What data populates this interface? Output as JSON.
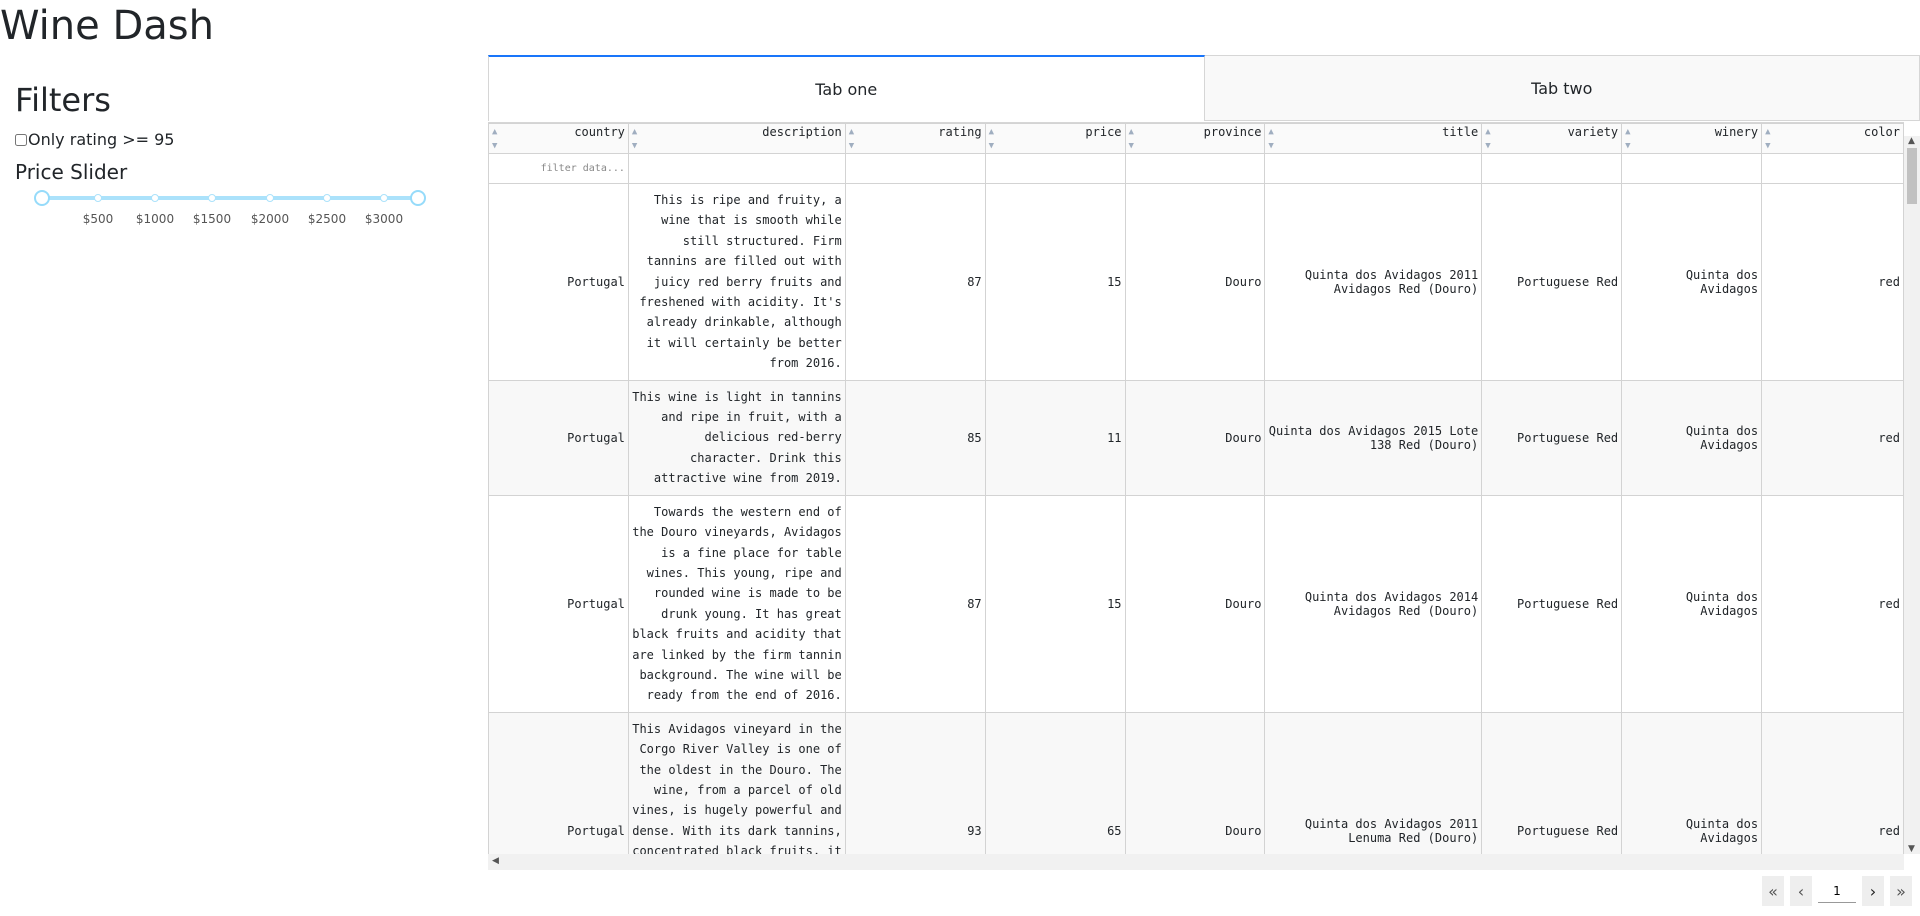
{
  "app": {
    "title": "Wine Dash"
  },
  "sidebar": {
    "filters_title": "Filters",
    "rating_checkbox_label": "Only rating >= 95",
    "rating_checked": false,
    "price_slider": {
      "title": "Price Slider",
      "marks": [
        "$500",
        "$1000",
        "$1500",
        "$2000",
        "$2500",
        "$3000"
      ],
      "range": [
        0,
        3300
      ],
      "selected": [
        0,
        3300
      ],
      "accent": "#96dbfa"
    }
  },
  "tabs": [
    {
      "label": "Tab one",
      "active": true
    },
    {
      "label": "Tab two",
      "active": false
    }
  ],
  "table": {
    "columns": [
      "country",
      "description",
      "rating",
      "price",
      "province",
      "title",
      "variety",
      "winery",
      "color"
    ],
    "filter_placeholder": "filter data...",
    "rows": [
      {
        "country": "Portugal",
        "description": "This is ripe and fruity, a wine that is smooth while still structured. Firm tannins are filled out with juicy red berry fruits and freshened with acidity. It's already drinkable, although it will certainly be better from 2016.",
        "rating": "87",
        "price": "15",
        "province": "Douro",
        "title": "Quinta dos Avidagos 2011 Avidagos Red (Douro)",
        "variety": "Portuguese Red",
        "winery": "Quinta dos Avidagos",
        "color": "red"
      },
      {
        "country": "Portugal",
        "description": "This wine is light in tannins and ripe in fruit, with a delicious red-berry character. Drink this attractive wine from 2019.",
        "rating": "85",
        "price": "11",
        "province": "Douro",
        "title": "Quinta dos Avidagos 2015 Lote 138 Red (Douro)",
        "variety": "Portuguese Red",
        "winery": "Quinta dos Avidagos",
        "color": "red"
      },
      {
        "country": "Portugal",
        "description": "Towards the western end of the Douro vineyards, Avidagos is a fine place for table wines. This young, ripe and rounded wine is made to be drunk young. It has great black fruits and acidity that are linked by the firm tannin background. The wine will be ready from the end of 2016.",
        "rating": "87",
        "price": "15",
        "province": "Douro",
        "title": "Quinta dos Avidagos 2014 Avidagos Red (Douro)",
        "variety": "Portuguese Red",
        "winery": "Quinta dos Avidagos",
        "color": "red"
      },
      {
        "country": "Portugal",
        "description": "This Avidagos vineyard in the Corgo River Valley is one of the oldest in the Douro. The wine, from a parcel of old vines, is hugely powerful and dense. With its dark tannins, concentrated black fruits, it could be too much. Somehow it manages to be balanced and impressive. It will age for many years.",
        "rating": "93",
        "price": "65",
        "province": "Douro",
        "title": "Quinta dos Avidagos 2011 Lenuma Red (Douro)",
        "variety": "Portuguese Red",
        "winery": "Quinta dos Avidagos",
        "color": "red"
      }
    ]
  },
  "pagination": {
    "first_icon": "double-chevron-left-icon",
    "prev_icon": "chevron-left-icon",
    "next_icon": "chevron-right-icon",
    "last_icon": "double-chevron-right-icon",
    "current_page": "1"
  }
}
